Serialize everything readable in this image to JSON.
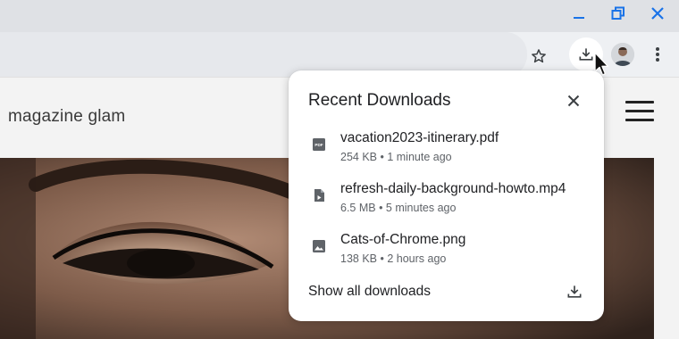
{
  "window": {
    "minimize_icon": "minimize-icon",
    "restore_icon": "restore-icon",
    "close_icon": "close-icon",
    "accent_color": "#1a73e8"
  },
  "toolbar": {
    "bookmark_icon": "star-icon",
    "downloads_icon": "download-icon",
    "profile_icon": "avatar",
    "menu_icon": "more-vert-icon"
  },
  "page": {
    "site_title": "magazine glam",
    "menu_icon": "hamburger-icon"
  },
  "downloads_bubble": {
    "title": "Recent Downloads",
    "close_icon": "close-icon",
    "items": [
      {
        "icon": "pdf-file-icon",
        "name": "vacation2023-itinerary.pdf",
        "meta": "254 KB • 1 minute ago"
      },
      {
        "icon": "video-file-icon",
        "name": "refresh-daily-background-howto.mp4",
        "meta": "6.5 MB • 5 minutes ago"
      },
      {
        "icon": "image-file-icon",
        "name": "Cats-of-Chrome.png",
        "meta": "138 KB • 2 hours ago"
      }
    ],
    "show_all_label": "Show all downloads",
    "show_all_icon": "download-icon"
  }
}
